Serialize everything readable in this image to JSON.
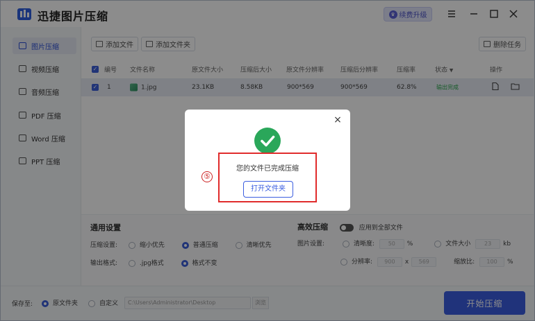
{
  "app": {
    "title": "迅捷图片压缩",
    "upgrade_label": "续费升级"
  },
  "sidebar": {
    "items": [
      {
        "label": "图片压缩",
        "icon": "image-icon",
        "active": true
      },
      {
        "label": "视频压缩",
        "icon": "video-icon",
        "active": false
      },
      {
        "label": "音频压缩",
        "icon": "audio-icon",
        "active": false
      },
      {
        "label": "PDF 压缩",
        "icon": "pdf-icon",
        "active": false
      },
      {
        "label": "Word 压缩",
        "icon": "word-icon",
        "active": false
      },
      {
        "label": "PPT 压缩",
        "icon": "ppt-icon",
        "active": false
      }
    ]
  },
  "toolbar": {
    "add_file": "添加文件",
    "add_folder": "添加文件夹",
    "delete_task": "删除任务"
  },
  "table": {
    "headers": [
      "编号",
      "文件名称",
      "原文件大小",
      "压缩后大小",
      "原文件分辨率",
      "压缩后分辨率",
      "压缩率",
      "状态",
      "操作"
    ],
    "rows": [
      {
        "index": "1",
        "name": "1.jpg",
        "orig_size": "23.1KB",
        "new_size": "8.58KB",
        "orig_res": "900*569",
        "new_res": "900*569",
        "ratio": "62.8%",
        "status": "输出完成"
      }
    ]
  },
  "settings": {
    "general_title": "通用设置",
    "compress_label": "压缩设置:",
    "compress_options": [
      "缩小优先",
      "普通压缩",
      "清晰优先"
    ],
    "compress_selected": 1,
    "output_label": "输出格式:",
    "output_options": [
      ".jpg格式",
      "格式不变"
    ],
    "output_selected": 1,
    "efficient_title": "高效压缩",
    "apply_all": "应用到全部文件",
    "image_label": "图片设置:",
    "clarity": "清晰度:",
    "clarity_value": "50",
    "percent": "%",
    "file_size": "文件大小",
    "file_size_value": "23",
    "kb": "kb",
    "resolution": "分辨率:",
    "res_w": "900",
    "res_x": "x",
    "res_h": "569",
    "scale": "缩放比:",
    "scale_value": "100",
    "scale_unit": "%"
  },
  "bottom": {
    "save_to": "保存至:",
    "opt_original": "原文件夹",
    "opt_custom": "自定义",
    "path": "C:\\Users\\Administrator\\Desktop",
    "browse": "浏览",
    "start": "开始压缩"
  },
  "modal": {
    "message": "您的文件已完成压缩",
    "open_folder": "打开文件夹",
    "close": "×",
    "step_marker": "⑤"
  },
  "colors": {
    "accent": "#3b5ee0",
    "success": "#2aa75a",
    "highlight": "#e02b2b"
  }
}
